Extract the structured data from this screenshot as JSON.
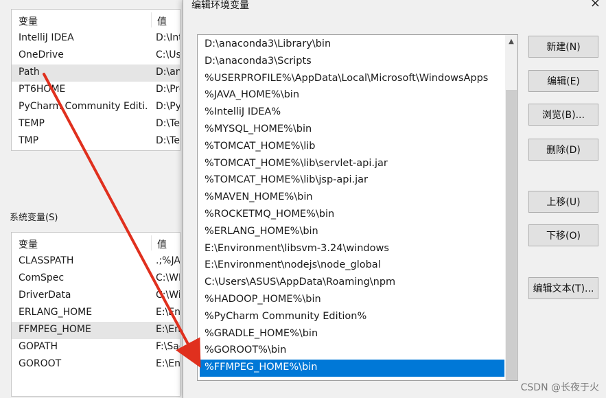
{
  "user_vars": {
    "header": {
      "name": "变量",
      "value": "值"
    },
    "rows": [
      {
        "name": "IntelliJ IDEA",
        "value": "D:\\Int"
      },
      {
        "name": "OneDrive",
        "value": "C:\\Use"
      },
      {
        "name": "Path",
        "value": "D:\\ana",
        "selected": true
      },
      {
        "name": "PT6HOME",
        "value": "D:\\Pro"
      },
      {
        "name": "PyCharm Community Editi...",
        "value": "D:\\Py"
      },
      {
        "name": "TEMP",
        "value": "D:\\Te"
      },
      {
        "name": "TMP",
        "value": "D:\\Te"
      }
    ]
  },
  "system_vars": {
    "label": "系统变量(S)",
    "header": {
      "name": "变量",
      "value": "值"
    },
    "rows": [
      {
        "name": "CLASSPATH",
        "value": ".;%JAV"
      },
      {
        "name": "ComSpec",
        "value": "C:\\WI"
      },
      {
        "name": "DriverData",
        "value": "C:\\Wi"
      },
      {
        "name": "ERLANG_HOME",
        "value": "E:\\En"
      },
      {
        "name": "FFMPEG_HOME",
        "value": "E:\\En",
        "selected": true
      },
      {
        "name": "GOPATH",
        "value": "F:\\Sac"
      },
      {
        "name": "GOROOT",
        "value": "E:\\Env"
      }
    ]
  },
  "dialog": {
    "title": "编辑环境变量",
    "close_icon": "×",
    "paths": [
      "D:\\anaconda3\\Library\\bin",
      "D:\\anaconda3\\Scripts",
      "%USERPROFILE%\\AppData\\Local\\Microsoft\\WindowsApps",
      "%JAVA_HOME%\\bin",
      "%IntelliJ IDEA%",
      "%MYSQL_HOME%\\bin",
      "%TOMCAT_HOME%\\lib",
      "%TOMCAT_HOME%\\lib\\servlet-api.jar",
      "%TOMCAT_HOME%\\lib\\jsp-api.jar",
      "%MAVEN_HOME%\\bin",
      "%ROCKETMQ_HOME%\\bin",
      "%ERLANG_HOME%\\bin",
      "E:\\Environment\\libsvm-3.24\\windows",
      "E:\\Environment\\nodejs\\node_global",
      "C:\\Users\\ASUS\\AppData\\Roaming\\npm",
      "%HADOOP_HOME%\\bin",
      "%PyCharm Community Edition%",
      "%GRADLE_HOME%\\bin",
      "%GOROOT%\\bin",
      "%FFMPEG_HOME%\\bin"
    ],
    "selected_index": 19,
    "buttons": {
      "new": "新建(N)",
      "edit": "编辑(E)",
      "browse": "浏览(B)...",
      "delete": "删除(D)",
      "move_up": "上移(U)",
      "move_down": "下移(O)",
      "edit_text": "编辑文本(T)..."
    },
    "scroll_up_icon": "▲"
  },
  "watermark": "CSDN @长夜于火",
  "colors": {
    "selection": "#0078d7",
    "arrow": "#e0301e"
  }
}
